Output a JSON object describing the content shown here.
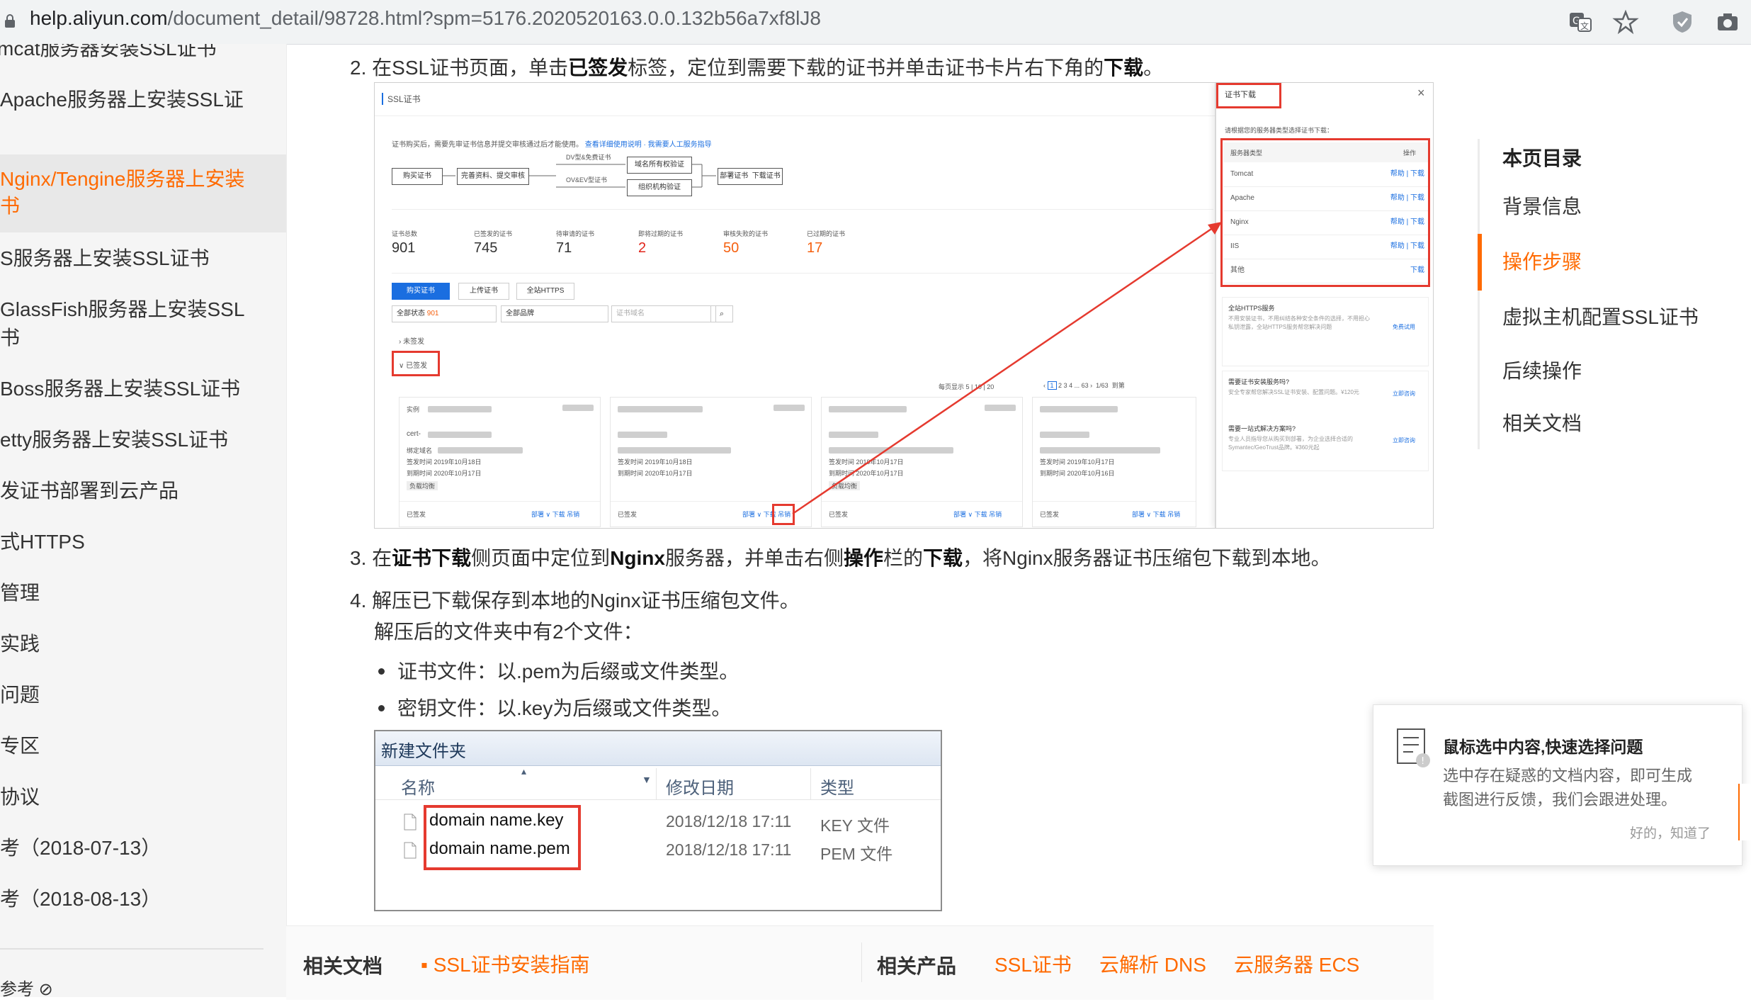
{
  "browser": {
    "url_host": "help.aliyun.com",
    "url_path": "/document_detail/98728.html?spm=5176.2020520163.0.0.132b56a7xf8lJ8"
  },
  "sidebar": {
    "items": [
      {
        "label": "mcat服务器安装SSL证书"
      },
      {
        "label": "Apache服务器上安装SSL证"
      },
      {
        "label": "Nginx/Tengine服务器上安装"
      },
      {
        "label": "书"
      },
      {
        "label": "S服务器上安装SSL证书"
      },
      {
        "label": "GlassFish服务器上安装SSL"
      },
      {
        "label": "书"
      },
      {
        "label": "Boss服务器上安装SSL证书"
      },
      {
        "label": "etty服务器上安装SSL证书"
      },
      {
        "label": "发证书部署到云产品"
      },
      {
        "label": "式HTTPS"
      },
      {
        "label": "管理"
      },
      {
        "label": "实践"
      },
      {
        "label": "问题"
      },
      {
        "label": "专区"
      },
      {
        "label": "协议"
      },
      {
        "label": "考（2018-07-13）"
      },
      {
        "label": "考（2018-08-13）"
      },
      {
        "label": "参考 ⊘"
      }
    ]
  },
  "steps": {
    "s2_num": "2.",
    "s2_a": "在SSL证书页面，单击",
    "s2_b": "已签发",
    "s2_c": "标签，定位到需要下载的证书并单击证书卡片右下角的",
    "s2_d": "下载",
    "s2_e": "。",
    "s3_num": "3.",
    "s3_a": "在",
    "s3_b": "证书下载",
    "s3_c": "侧页面中定位到",
    "s3_d": "Nginx",
    "s3_e": "服务器，并单击右侧",
    "s3_f": "操作",
    "s3_g": "栏的",
    "s3_h": "下载",
    "s3_i": "，将Nginx服务器证书压缩包下载到本地。",
    "s4_num": "4.",
    "s4_a": "解压已下载保存到本地的Nginx证书压缩包文件。",
    "s4_sub": "解压后的文件夹中有2个文件：",
    "bullet1": "证书文件：以.pem为后缀或文件类型。",
    "bullet2": "密钥文件：以.key为后缀或文件类型。"
  },
  "shot1": {
    "title": "SSL证书",
    "intro": "证书购买后，需要先审证书信息并提交审核通过后才能使用。",
    "intro_link": "查看详细使用说明 · 我需要人工服务指导",
    "flow": [
      "购买证书",
      "完善资料、提交审核",
      "DV型&免费证书",
      "域名所有权验证",
      "OV&EV型证书",
      "组织机构验证",
      "部署证书",
      "下载证书"
    ],
    "stats": [
      {
        "label": "证书总数",
        "value": "901"
      },
      {
        "label": "已签发的证书",
        "value": "745"
      },
      {
        "label": "待审请的证书",
        "value": "71"
      },
      {
        "label": "即将过期的证书",
        "value": "2"
      },
      {
        "label": "审核失败的证书",
        "value": "50"
      },
      {
        "label": "已过期的证书",
        "value": "17"
      }
    ],
    "buttons": [
      "购买证书",
      "上传证书",
      "全站HTTPS"
    ],
    "filter_status": "全部状态",
    "filter_count": "901",
    "filter_brand": "全部品牌",
    "filter_domain": "证书域名",
    "section_unsigned": "未签发",
    "section_signed": "已签发",
    "pagination": {
      "per_page": "每页显示",
      "sizes": [
        "5",
        "10",
        "20"
      ],
      "pages": [
        "1",
        "2",
        "3",
        "4",
        "...",
        "63"
      ],
      "total": "1/63",
      "goto": "到第"
    },
    "cards": [
      {
        "head": "实例",
        "name": "cert-",
        "bind": "绑定域名",
        "issued": "签发时间 2019年10月18日",
        "expire": "到期时间 2020年10月17日",
        "tag": "负载均衡",
        "status": "已签发",
        "actions": "部署 ∨  下载  吊销"
      },
      {
        "head": "",
        "name": "",
        "bind": "",
        "issued": "签发时间 2019年10月18日",
        "expire": "到期时间 2020年10月17日",
        "tag": "",
        "status": "已签发",
        "actions": "部署 ∨  下载  吊销"
      },
      {
        "head": "",
        "name": "",
        "bind": "",
        "issued": "签发时间 2019年10月17日",
        "expire": "到期时间 2020年10月17日",
        "tag": "负载均衡",
        "status": "已签发",
        "actions": "部署 ∨  下载  吊销"
      },
      {
        "head": "",
        "name": "",
        "bind": "",
        "issued": "签发时间 2019年10月17日",
        "expire": "到期时间 2020年10月16日",
        "tag": "",
        "status": "已签发",
        "actions": "部署 ∨  下载  吊销"
      }
    ],
    "panel": {
      "title": "证书下载",
      "close": "×",
      "hint": "请根据您的服务器类型选择证书下载：",
      "col_type": "服务器类型",
      "col_op": "操作",
      "rows": [
        {
          "type": "Tomcat",
          "op": "帮助 | 下载"
        },
        {
          "type": "Apache",
          "op": "帮助 | 下载"
        },
        {
          "type": "Nginx",
          "op": "帮助 | 下载"
        },
        {
          "type": "IIS",
          "op": "帮助 | 下载"
        },
        {
          "type": "其他",
          "op": "下载"
        }
      ],
      "promo1_title": "全站HTTPS服务",
      "promo1_text": "不用安装证书，不用纠结各种安全条件的选择，不用担心私钥泄露，全站HTTPS服务帮您解决问题",
      "promo1_link": "免费试用",
      "promo2_title": "需要证书安装服务吗?",
      "promo2_text": "安全专家帮您解决SSL证书安装、配置问题。¥120元",
      "promo2_link": "立即咨询",
      "promo3_title": "需要一站式解决方案吗?",
      "promo3_text": "专业人员指导您从购买到部署，为企业选择合适的Symantec/GeoTrust品牌。¥360元起",
      "promo3_link": "立即咨询"
    }
  },
  "shot2": {
    "folder": "新建文件夹",
    "col_name": "名称",
    "col_date": "修改日期",
    "col_type": "类型",
    "files": [
      {
        "name": "domain name.key",
        "date": "2018/12/18 17:11",
        "type": "KEY 文件"
      },
      {
        "name": "domain name.pem",
        "date": "2018/12/18 17:11",
        "type": "PEM 文件"
      }
    ]
  },
  "toc": {
    "title": "本页目录",
    "items": [
      "背景信息",
      "操作步骤",
      "虚拟主机配置SSL证书",
      "后续操作",
      "相关文档"
    ]
  },
  "feedback": {
    "title": "鼠标选中内容,快速选择问题",
    "line1": "选中存在疑惑的文档内容，即可生成",
    "line2": "截图进行反馈，我们会跟进处理。",
    "dismiss": "好的，知道了"
  },
  "bottom": {
    "docs_head": "相关文档",
    "docs_link": "SSL证书安装指南",
    "products_head": "相关产品",
    "products": [
      "SSL证书",
      "云解析 DNS",
      "云服务器 ECS"
    ]
  },
  "colors": {
    "accent": "#ff6a00",
    "annot": "#e53a2f",
    "link_blue": "#1a6ee0"
  }
}
